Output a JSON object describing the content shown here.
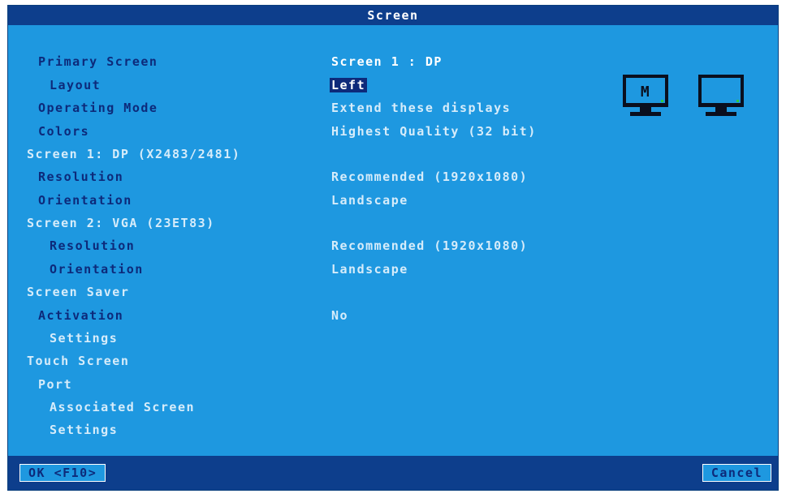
{
  "window": {
    "title": "Screen"
  },
  "rows": [
    {
      "label": "Primary Screen",
      "value": "Screen 1 : DP"
    },
    {
      "label": "Layout",
      "value": "Left"
    },
    {
      "label": "Operating Mode",
      "value": "Extend these displays"
    },
    {
      "label": "Colors",
      "value": "Highest Quality (32 bit)"
    },
    {
      "label": "Screen 1: DP (X2483/2481)",
      "value": ""
    },
    {
      "label": "Resolution",
      "value": "Recommended (1920x1080)"
    },
    {
      "label": "Orientation",
      "value": "Landscape"
    },
    {
      "label": "Screen 2: VGA (23ET83)",
      "value": ""
    },
    {
      "label": "Resolution",
      "value": "Recommended (1920x1080)"
    },
    {
      "label": "Orientation",
      "value": "Landscape"
    },
    {
      "label": "Screen Saver",
      "value": ""
    },
    {
      "label": "Activation",
      "value": "No"
    },
    {
      "label": "Settings",
      "value": ""
    },
    {
      "label": "Touch Screen",
      "value": ""
    },
    {
      "label": "Port",
      "value": ""
    },
    {
      "label": "Associated Screen",
      "value": ""
    },
    {
      "label": "Settings",
      "value": ""
    }
  ],
  "monitors": {
    "primary_letter": "M",
    "icons": [
      "monitor-primary-icon",
      "monitor-secondary-icon"
    ]
  },
  "buttons": {
    "ok_label": "OK <F10>",
    "cancel_label": "Cancel"
  },
  "colors": {
    "background": "#1e98e0",
    "titlebar": "#0d3e8c",
    "navy_text": "#0d2a7a",
    "white_text": "#ffffff"
  }
}
